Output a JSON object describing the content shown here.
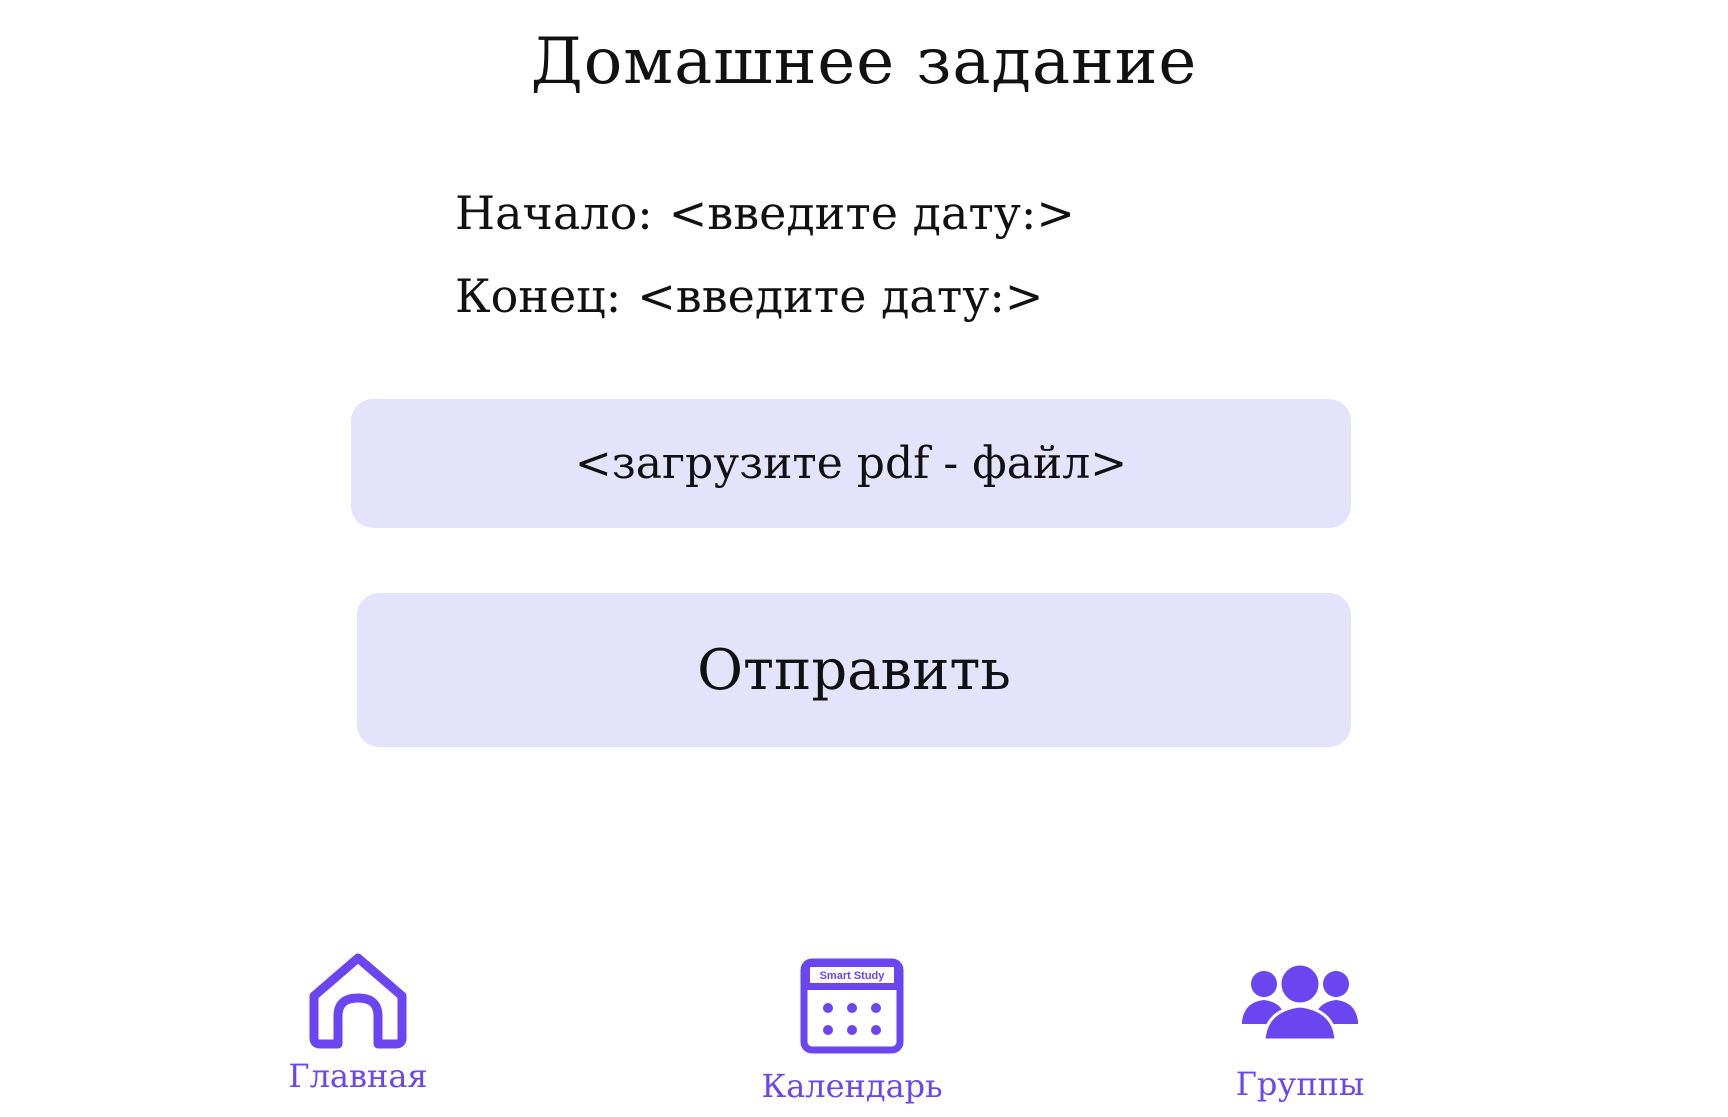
{
  "page": {
    "title": "Домашнее задание"
  },
  "dates": {
    "start_label": "Начало:",
    "start_value": "<введите дату:>",
    "end_label": "Конец:",
    "end_value": "<введите дату:>"
  },
  "upload": {
    "label": "<загрузите pdf - файл>"
  },
  "submit": {
    "label": "Отправить"
  },
  "nav": {
    "home_label": "Главная",
    "calendar_label": "Календарь",
    "calendar_icon_text": "Smart Study",
    "groups_label": "Группы"
  },
  "colors": {
    "accent": "#6b46f0",
    "button_bg": "#e4e3fc",
    "text": "#111111",
    "background": "#ffffff"
  },
  "icons": {
    "home": "house-icon",
    "calendar": "calendar-icon",
    "groups": "users-group-icon"
  }
}
